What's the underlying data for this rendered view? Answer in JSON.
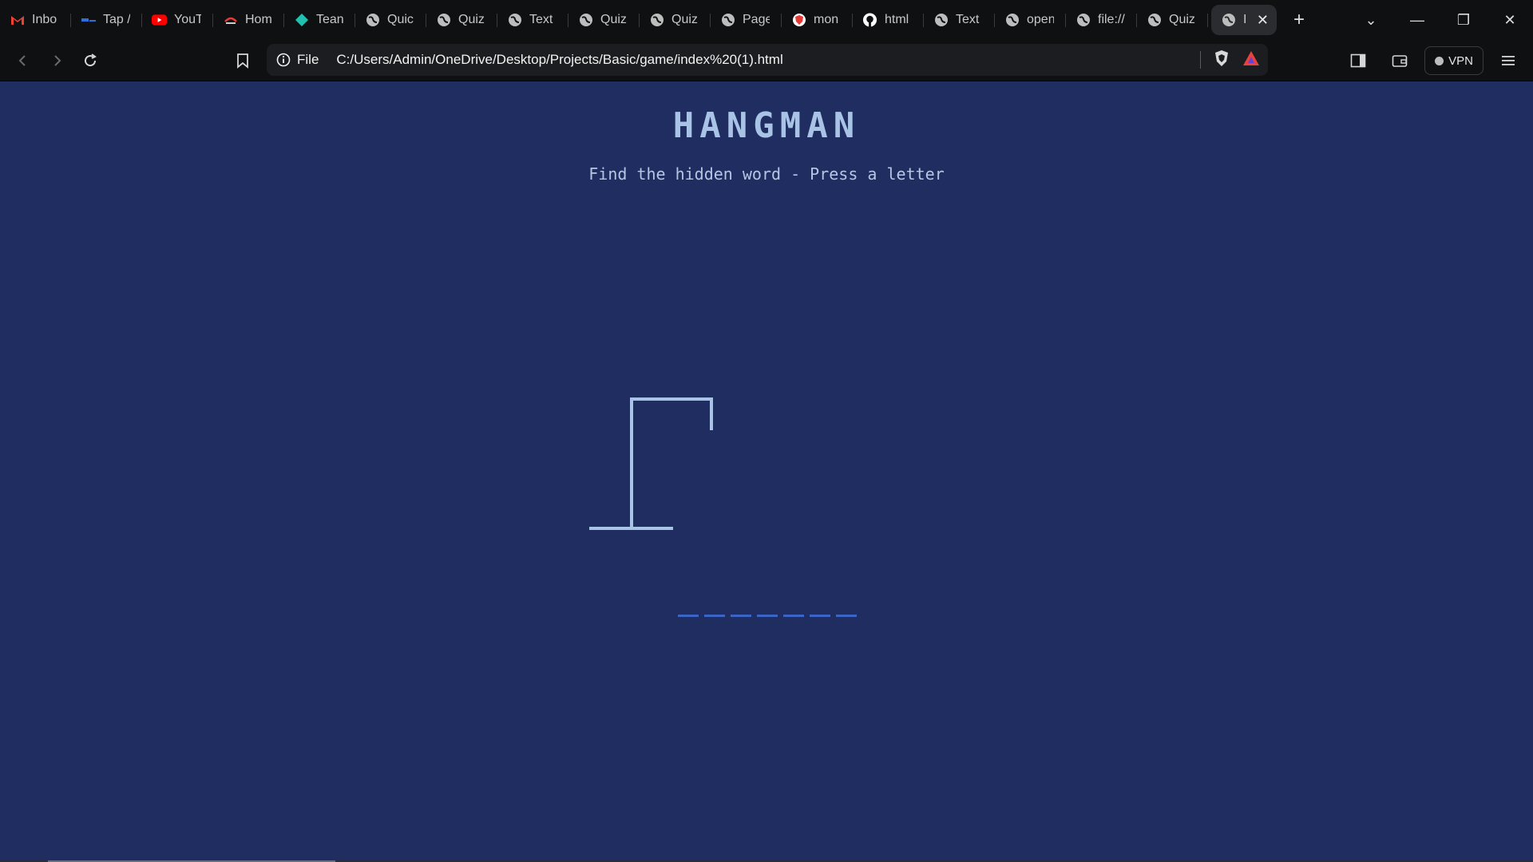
{
  "browser": {
    "tabs": [
      {
        "title": "Inbo",
        "icon": "gmail-icon",
        "color": "#ea4335"
      },
      {
        "title": "Tap /",
        "icon": "tap-icon",
        "color": "#2f6fd6"
      },
      {
        "title": "YouT",
        "icon": "youtube-icon",
        "color": "#ff0000"
      },
      {
        "title": "Hom",
        "icon": "home-icon",
        "color": "#e53935"
      },
      {
        "title": "Tean",
        "icon": "diamond-icon",
        "color": "#1fc2b0"
      },
      {
        "title": "Quic",
        "icon": "globe-icon",
        "color": "#bdbdbd"
      },
      {
        "title": "Quiz",
        "icon": "globe-icon",
        "color": "#bdbdbd"
      },
      {
        "title": "Text",
        "icon": "globe-icon",
        "color": "#bdbdbd"
      },
      {
        "title": "Quiz",
        "icon": "globe-icon",
        "color": "#bdbdbd"
      },
      {
        "title": "Quiz",
        "icon": "globe-icon",
        "color": "#bdbdbd"
      },
      {
        "title": "Page",
        "icon": "globe-icon",
        "color": "#bdbdbd"
      },
      {
        "title": "mon",
        "icon": "shield-icon",
        "color": "#e53935"
      },
      {
        "title": "html",
        "icon": "github-icon",
        "color": "#ffffff"
      },
      {
        "title": "Text",
        "icon": "globe-icon",
        "color": "#bdbdbd"
      },
      {
        "title": "open",
        "icon": "globe-icon",
        "color": "#bdbdbd"
      },
      {
        "title": "file://",
        "icon": "globe-icon",
        "color": "#bdbdbd"
      },
      {
        "title": "Quiz",
        "icon": "globe-icon",
        "color": "#bdbdbd"
      }
    ],
    "active_tab": {
      "title": "I",
      "icon": "globe-icon"
    },
    "new_tab_label": "+",
    "window_controls": {
      "tab_search": "⌄",
      "minimize": "—",
      "restore": "❐",
      "close": "✕"
    },
    "site_info_label": "File",
    "url": "C:/Users/Admin/OneDrive/Desktop/Projects/Basic/game/index%20(1).html",
    "vpn_label": "VPN"
  },
  "game": {
    "title": "HANGMAN",
    "subtitle": "Find the hidden word - Press a letter",
    "letter_count": 7,
    "colors": {
      "background": "#1f2d61",
      "gallows": "#a9c3e6",
      "blanks": "#3b64c4"
    }
  }
}
